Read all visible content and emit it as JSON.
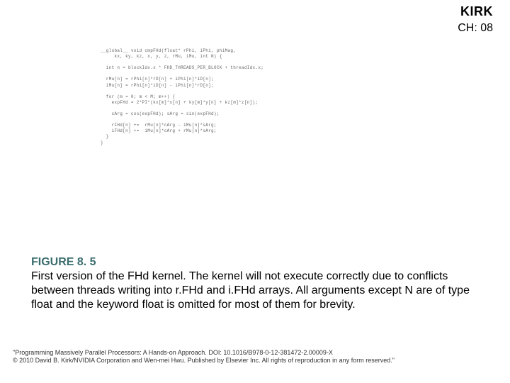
{
  "header": {
    "author": "KIRK",
    "chapter": "CH: 08"
  },
  "code": "__global__ void cmpFHd(float* rPhi, iPhi, phiMag,\n     kx, ky, kz, x, y, z, rMu, iMu, int N) {\n\n  int n = blockIdx.x * FHD_THREADS_PER_BLOCK + threadIdx.x;\n\n  rMu[n] = rPhi[n]*rD[n] + iPhi[n]*iD[n];\n  iMu[n] = rPhi[n]*iD[n] - iPhi[n]*rD[n];\n\n  for (m = 0; m < M; m++) {\n    expFHd = 2*PI*(kx[m]*x[n] + ky[m]*y[n] + kz[m]*z[n]);\n\n    cArg = cos(expFHd); sArg = sin(expFHd);\n\n    rFHd[n] +=  rMu[n]*cArg - iMu[n]*sArg;\n    iFHd[n] +=  iMu[n]*cArg + rMu[n]*sArg;\n  }\n}",
  "figure": {
    "label": "FIGURE 8. 5",
    "text": "First version of the FHd kernel. The kernel will not execute correctly due to conflicts between threads writing into r.FHd and i.FHd arrays. All arguments except N are of type float and the keyword float is omitted for most of them for brevity."
  },
  "footer": {
    "line1": "\"Programming Massively Parallel Processors: A Hands-on Approach. DOI: 10.1016/B978-0-12-381472-2.00009-X",
    "line2": "© 2010 David B. Kirk/NVIDIA Corporation and Wen-mei Hwu. Published by Elsevier Inc. All rights of reproduction in any form reserved.\""
  }
}
